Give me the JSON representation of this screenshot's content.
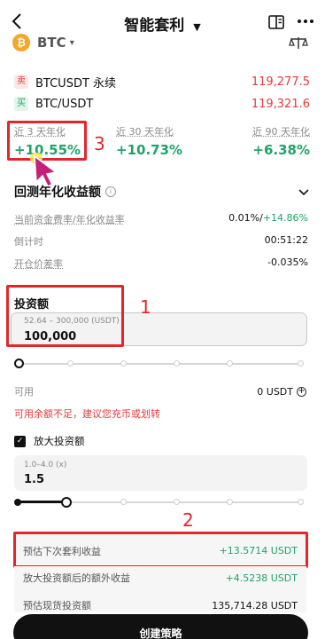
{
  "header": {
    "title": "智能套利"
  },
  "coin": {
    "symbol": "BTC"
  },
  "pairs": [
    {
      "tag": "卖",
      "name": "BTCUSDT 永续",
      "price": "119,277.5"
    },
    {
      "tag": "买",
      "name": "BTC/USDT",
      "price": "119,321.6"
    }
  ],
  "apy": [
    {
      "label": "近 3 天年化",
      "value": "+10.55%"
    },
    {
      "label": "近 30 天年化",
      "value": "+10.73%"
    },
    {
      "label": "近 90 天年化",
      "value": "+6.38%"
    }
  ],
  "backtest": {
    "title": "回测年化收益额",
    "rows": [
      {
        "label": "当前资金费率/年化收益率",
        "value_a": "0.01%/",
        "value_b": "+14.86%"
      },
      {
        "label": "倒计时",
        "value": "00:51:22"
      },
      {
        "label": "开仓价差率",
        "value": "-0.035%"
      }
    ]
  },
  "investment": {
    "label": "投资额",
    "range": "52.64 – 300,000 (USDT)",
    "value": "100,000",
    "slider_fraction": 0
  },
  "available": {
    "label": "可用",
    "value": "0 USDT",
    "warning": "可用余额不足，建议您充币或划转"
  },
  "leverage": {
    "checkbox_label": "放大投资额",
    "checked": true,
    "range": "1.0–4.0 (x)",
    "value": "1.5",
    "slider_fraction": 0.1667
  },
  "estimates": [
    {
      "label": "预估下次套利收益",
      "value": "+13.5714 USDT"
    },
    {
      "label": "放大投资额后的额外收益",
      "value": "+4.5238 USDT"
    },
    {
      "label": "预估现货投资额",
      "value": "135,714.28 USDT"
    }
  ],
  "cta": {
    "label": "创建策略"
  },
  "annotations": {
    "n1": "1",
    "n2": "2",
    "n3": "3"
  },
  "colors": {
    "green": "#1fa36b",
    "red": "#e23b3b",
    "annotation": "#e3262b",
    "cta_bg": "#111111"
  }
}
